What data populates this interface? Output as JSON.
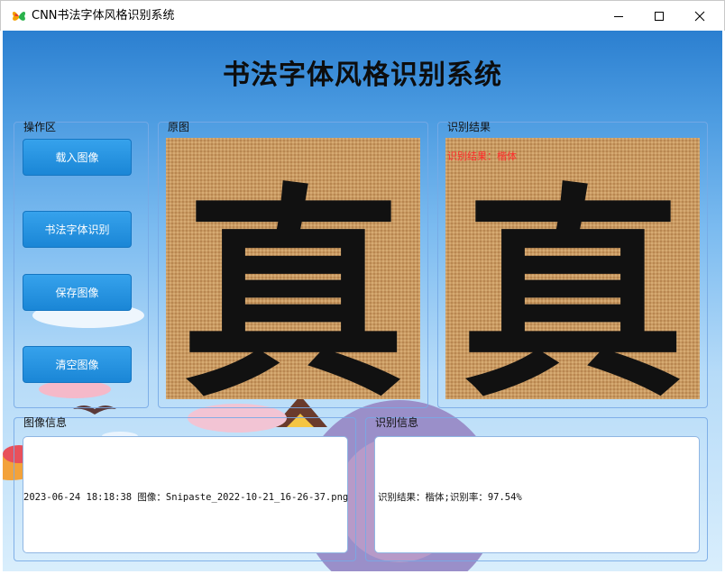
{
  "window": {
    "title": "CNN书法字体风格识别系统",
    "app_icon": "butterfly-icon",
    "controls": [
      "minimize-icon",
      "maximize-icon",
      "close-icon"
    ]
  },
  "header": {
    "title": "书法字体风格识别系统"
  },
  "operation_panel": {
    "label": "操作区",
    "buttons": {
      "load": "载入图像",
      "recognize": "书法字体识别",
      "save": "保存图像",
      "clear": "清空图像"
    }
  },
  "original_panel": {
    "label": "原图",
    "character": "真"
  },
  "result_panel": {
    "label": "识别结果",
    "character": "真",
    "overlay": "识别结果：楷体"
  },
  "image_info": {
    "label": "图像信息",
    "text": "2023-06-24 18:18:38 图像：Snipaste_2022-10-21_16-26-37.png"
  },
  "recognition_info": {
    "label": "识别信息",
    "text": "识别结果：楷体;识别率：97.54%"
  },
  "colors": {
    "accent_button": "#1a86d6",
    "overlay_text": "#ff2b2b",
    "panel_border": "#78aae6"
  }
}
